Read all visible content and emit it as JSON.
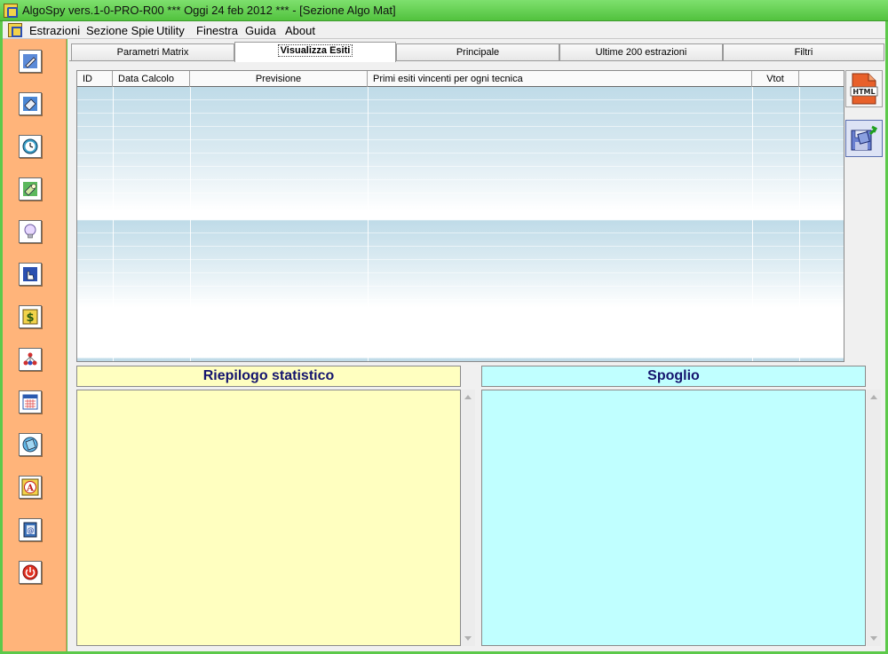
{
  "window": {
    "title": "AlgoSpy vers.1-0-PRO-R00  ***  Oggi 24 feb 2012  ***   - [Sezione Algo Mat]"
  },
  "menu": {
    "items": [
      "Estrazioni",
      "Sezione Spie",
      "Utility",
      "Finestra",
      "Guida",
      "About"
    ]
  },
  "sidebar": {
    "icons": [
      "pencil-icon",
      "eraser-icon",
      "clock-icon",
      "flashlight-icon",
      "lightbulb-icon",
      "hand-pointer-icon",
      "dollar-icon",
      "network-icon",
      "calendar-icon",
      "shape-icon",
      "letter-a-icon",
      "address-book-icon",
      "power-icon"
    ]
  },
  "tabs": [
    {
      "label": "Parametri Matrix"
    },
    {
      "label": "Visualizza Esiti"
    },
    {
      "label": "Principale"
    },
    {
      "label": "Ultime 200 estrazioni"
    },
    {
      "label": "Filtri"
    }
  ],
  "active_tab": "Visualizza Esiti",
  "grid": {
    "columns": [
      "ID",
      "Data Calcolo",
      "Previsione",
      "Primi esiti vincenti per ogni tecnica",
      "Vtot",
      ""
    ]
  },
  "tools": {
    "html_label": "HTML"
  },
  "panels": {
    "left_title": "Riepilogo statistico",
    "right_title": "Spoglio"
  },
  "colors": {
    "sidebar_bg": "#ffb47a",
    "riepilogo_bg": "#ffffc0",
    "spoglio_bg": "#c0ffff",
    "header_text": "#14146e"
  }
}
